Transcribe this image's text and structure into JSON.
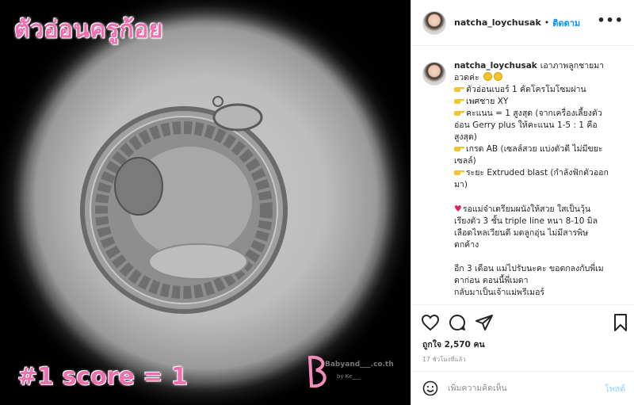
{
  "image": {
    "overlay_title": "ตัวอ่อนครูก้อย",
    "overlay_score": "#1 score = 1",
    "watermark_text": "Babyand___.co.th",
    "watermark_sub": "by Ke___"
  },
  "header": {
    "username": "natcha_loychusak",
    "separator": "•",
    "follow_label": "ติดตาม",
    "more_label": "•••"
  },
  "caption": {
    "username": "natcha_loychusak",
    "lines": [
      "เอาภาพลูกชายมา",
      "อวดค่ะ",
      "ตัวอ่อนเบอร์ 1 คัดโครโมโซมผ่าน",
      "เพศชาย XY",
      "คะแนน = 1 สูงสุด (จากเครื่องเลี้ยงตัว",
      "อ่อน Gerry plus ให้คะแนน 1-5 : 1 คือ",
      "สูงสุด)",
      "เกรด AB (เซลล์สวย แบ่งตัวดี ไม่มีขยะ",
      "เซลล์)",
      "ระยะ Extruded blast (กำลังฟักตัวออก",
      "มา)",
      "",
      "รอแม่จ๋าเตรียมผนังให้สวย ใสเป็นวุ้น",
      "เรียงตัว 3 ชั้น triple line หนา 8-10 มิล",
      "เลือดไหลเวียนดี มดลูกอุ่น ไม่มีสารพิษ",
      "ตกค้าง",
      "",
      "อีก 3 เดือน แม่ไปรับนะคะ ขอตกลงกับพี่เม",
      "ดาก่อน ตอนนี้พี่เมดา",
      "กลับมาเป็นเจ้าแม่พรีเมอร์"
    ]
  },
  "engagement": {
    "likes": "ถูกใจ 2,570 คน",
    "time_ago": "17 ชั่วโมงที่แล้ว"
  },
  "comment": {
    "placeholder": "เพิ่มความคิดเห็น",
    "post_label": "โพสต์"
  },
  "colors": {
    "overlay_pink": "#f06fae",
    "follow_blue": "#0095f6",
    "post_disabled": "#b2dffc",
    "heart_red": "#e0245e"
  }
}
